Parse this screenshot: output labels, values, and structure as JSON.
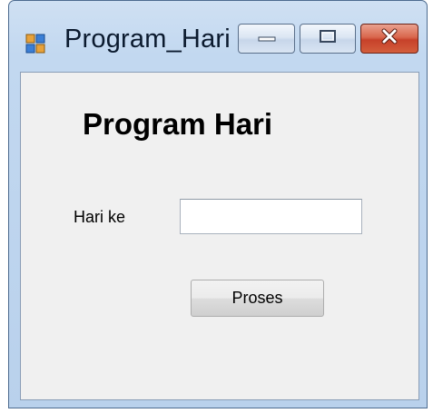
{
  "window": {
    "title": "Program_Hari",
    "icon": "winforms-app-icon",
    "caption_buttons": [
      "minimize-icon",
      "maximize-icon",
      "close-icon"
    ]
  },
  "form": {
    "heading": "Program Hari",
    "day_label": "Hari ke",
    "day_input_value": "",
    "submit_label": "Proses"
  },
  "colors": {
    "close_button": "#c7412a",
    "frame": "#c2d8f0",
    "client_background": "#f0f0f0"
  }
}
